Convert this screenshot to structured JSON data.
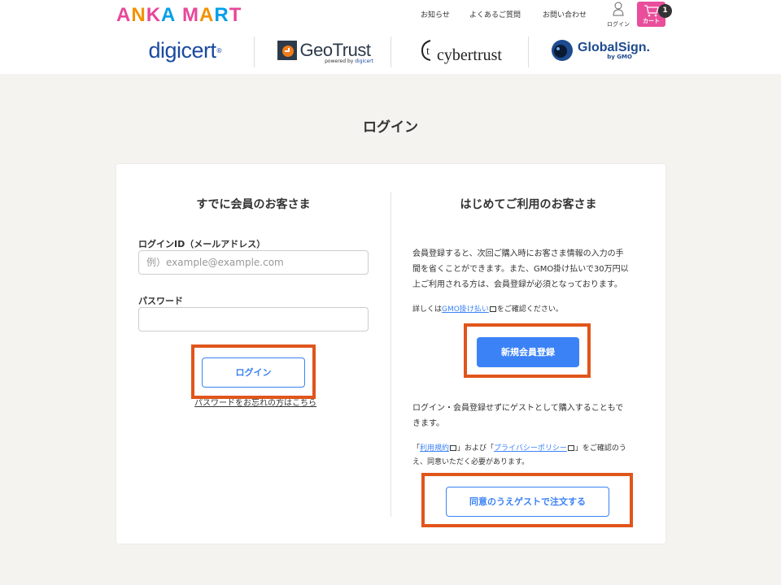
{
  "header": {
    "logo_letters": [
      "A",
      "N",
      "K",
      "A",
      " ",
      "M",
      "A",
      "R",
      "T"
    ],
    "logo_colors": [
      "#e8479a",
      "#f39200",
      "#e8479a",
      "#00a0e9",
      "#ffffff",
      "#e8479a",
      "#f39200",
      "#00a0e9",
      "#e8479a"
    ],
    "nav": {
      "news": "お知らせ",
      "faq": "よくあるご質問",
      "contact": "お問い合わせ"
    },
    "login_label": "ログイン",
    "cart_label": "カート",
    "cart_count": "1"
  },
  "brands": {
    "digicert": "digicert",
    "digicert_mark": "®",
    "geotrust": "GeoTrust",
    "geotrust_sub": "powered by",
    "geotrust_sub_brand": "digicert",
    "cybertrust": "cybertrust",
    "globalsign": "GlobalSign.",
    "globalsign_sub": "by GMO"
  },
  "page": {
    "title": "ログイン"
  },
  "member": {
    "title": "すでに会員のお客さま",
    "login_id_label": "ログインID（メールアドレス）",
    "login_id_placeholder": "例）example@example.com",
    "password_label": "パスワード",
    "login_button": "ログイン",
    "forgot_link": "パスワードをお忘れの方はこちら"
  },
  "newcomer": {
    "title": "はじめてご利用のお客さま",
    "intro_line1": "会員登録すると、次回ご購入時にお客さま情報の入力の手",
    "intro_line2": "間を省くことができます。また、GMO掛け払いで30万円以",
    "intro_line3": "上ご利用される方は、会員登録が必須となっております。",
    "details_prefix": "詳しくは",
    "details_link": "GMO掛け払い",
    "details_suffix": "をご確認ください。",
    "register_button": "新規会員登録",
    "guest_line1": "ログイン・会員登録せずにゲストとして購入することもで",
    "guest_line2": "きます。",
    "terms_open": "「",
    "terms_link": "利用規約",
    "terms_mid": "」および「",
    "privacy_link": "プライバシーポリシー",
    "terms_close": "」をご確認のう",
    "terms_line2": "え、同意いただく必要があります。",
    "guest_button": "同意のうえゲストで注文する"
  },
  "colors": {
    "accent": "#3b82f6",
    "highlight": "#e0551b",
    "cart": "#e94e9b",
    "background": "#f5f3f0"
  }
}
